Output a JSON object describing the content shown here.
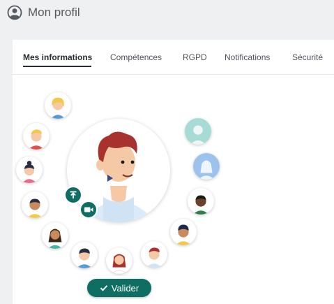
{
  "header": {
    "title": "Mon profil",
    "icon": "user-circle-icon"
  },
  "tabs": [
    {
      "label": "Mes informations",
      "active": true
    },
    {
      "label": "Compétences",
      "active": false
    },
    {
      "label": "RGPD",
      "active": false
    },
    {
      "label": "Notifications",
      "active": false
    },
    {
      "label": "Sécurité",
      "active": false
    }
  ],
  "avatar_picker": {
    "options": [
      "avatar-blonde-girl",
      "avatar-blonde-boy",
      "avatar-bun-girl",
      "avatar-dark-boy",
      "avatar-long-hair-woman",
      "avatar-boy-blue",
      "avatar-redhead-woman",
      "avatar-redhead-man",
      "avatar-dark-hair-man",
      "avatar-dark-skin-man",
      "avatar-silhouette-female",
      "avatar-silhouette-male"
    ],
    "upload_icon": "upload-icon",
    "camera_icon": "video-camera-icon"
  },
  "actions": {
    "validate_label": "Valider",
    "validate_icon": "check-icon"
  },
  "colors": {
    "accent": "#0f6e63",
    "background": "#eef0f2"
  }
}
